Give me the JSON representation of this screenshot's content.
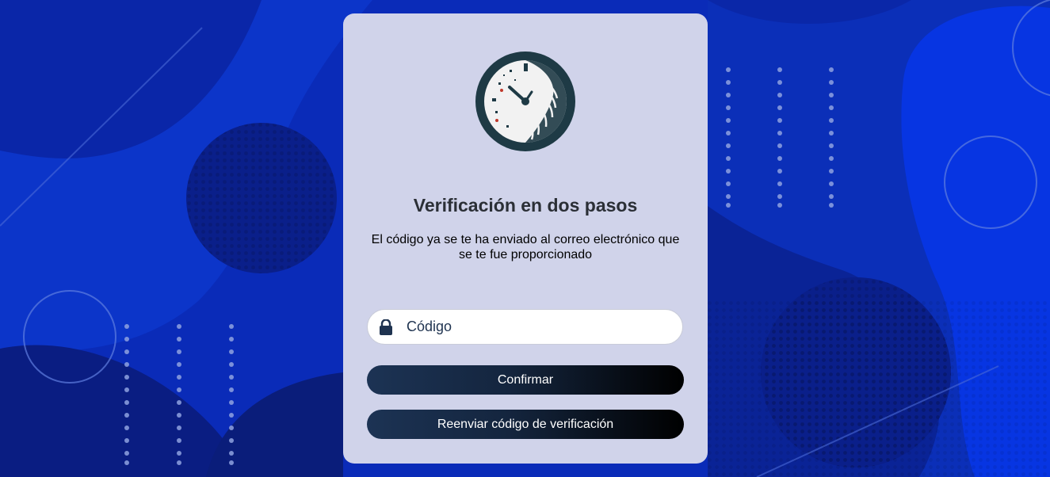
{
  "logo": {
    "icon": "clock-fingerprint-logo"
  },
  "title": "Verificación en dos pasos",
  "subtitle": "El código ya se te ha enviado al correo electrónico que se te fue proporcionado",
  "code_field": {
    "placeholder": "Código",
    "value": "",
    "icon": "lock-icon"
  },
  "buttons": {
    "confirm": "Confirmar",
    "resend": "Reenviar código de verificación"
  },
  "colors": {
    "background": "#0a2bb8",
    "card": "#d0d3ea",
    "button_start": "#1c3354",
    "button_end": "#000000",
    "title": "#2b2f36"
  }
}
